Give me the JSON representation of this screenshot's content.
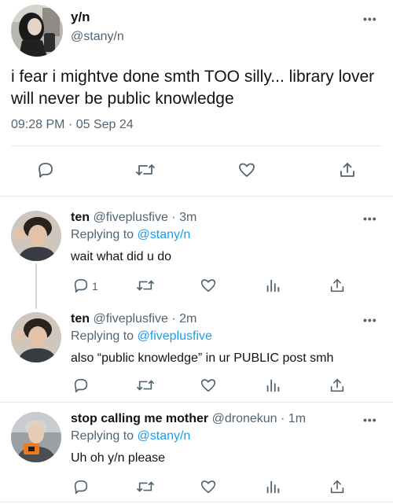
{
  "main_tweet": {
    "display_name": "y/n",
    "handle": "@stany/n",
    "text": "i fear i mightve done smth TOO silly... library lover will never be public knowledge",
    "timestamp": "09:28 PM · 05 Sep 24",
    "more_label": "•••"
  },
  "replies": [
    {
      "display_name": "ten",
      "handle": "@fiveplusfive",
      "dot": "·",
      "time": "3m",
      "replying_prefix": "Replying to",
      "replying_to": "@stany/n",
      "text": "wait what did u do",
      "reply_count": "1",
      "more_label": "•••"
    },
    {
      "display_name": "ten",
      "handle": "@fiveplusfive",
      "dot": "·",
      "time": "2m",
      "replying_prefix": "Replying to",
      "replying_to": "@fiveplusfive",
      "text": "also “public knowledge” in ur PUBLIC post smh",
      "reply_count": "",
      "more_label": "•••"
    },
    {
      "display_name": "stop calling me mother",
      "handle": "@dronekun",
      "dot": "·",
      "time": "1m",
      "replying_prefix": "Replying to",
      "replying_to": "@stany/n",
      "text": "Uh oh y/n please",
      "reply_count": "",
      "more_label": "•••"
    }
  ],
  "colors": {
    "link": "#1d9bf0",
    "secondary_text": "#536471",
    "border": "#e7e9ea"
  },
  "icons": [
    "reply-icon",
    "retweet-icon",
    "like-icon",
    "views-icon",
    "share-icon",
    "more-icon"
  ]
}
